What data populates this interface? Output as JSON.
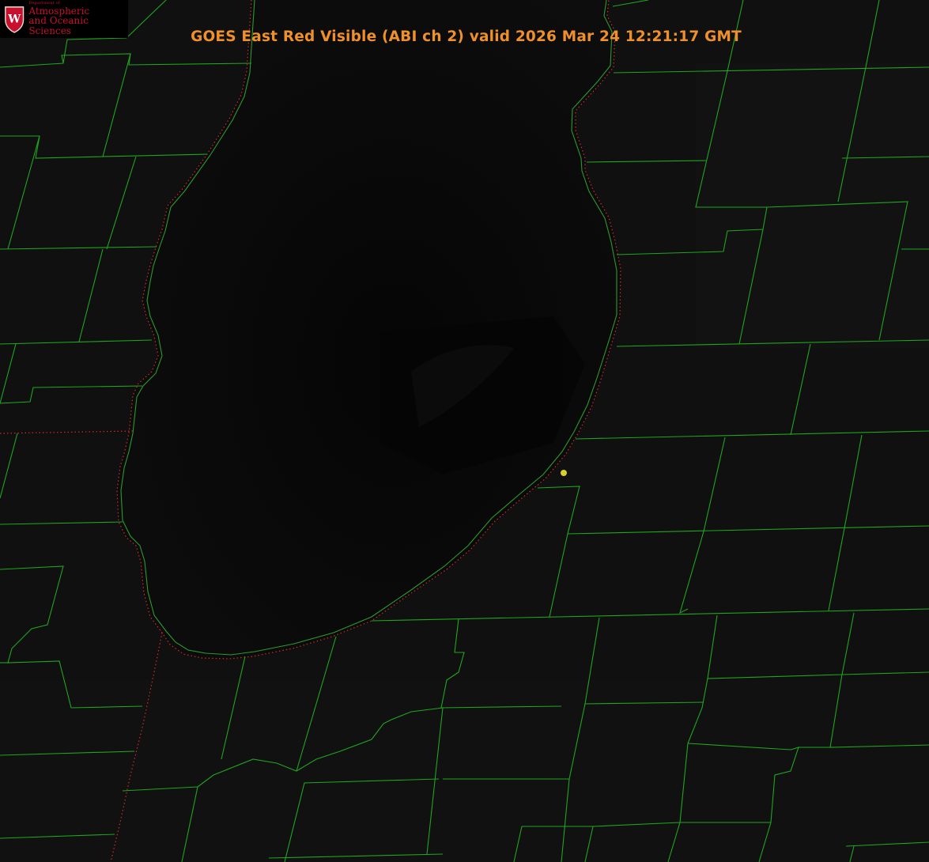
{
  "title": "GOES East Red Visible (ABI ch 2) valid 2026 Mar 24 12:21:17 GMT",
  "logo": {
    "dept": "Department of",
    "name_line1": "Atmospheric",
    "name_line2": "and Oceanic Sciences",
    "crest_letter": "W"
  },
  "colors": {
    "title": "#f0902a",
    "county_lines": "#1fa51f",
    "state_border": "#d22a2a",
    "marker": "#d7cf2a",
    "logo": "#c8102e"
  },
  "icons": {
    "marker": "location-dot-icon",
    "crest": "university-crest-icon"
  }
}
